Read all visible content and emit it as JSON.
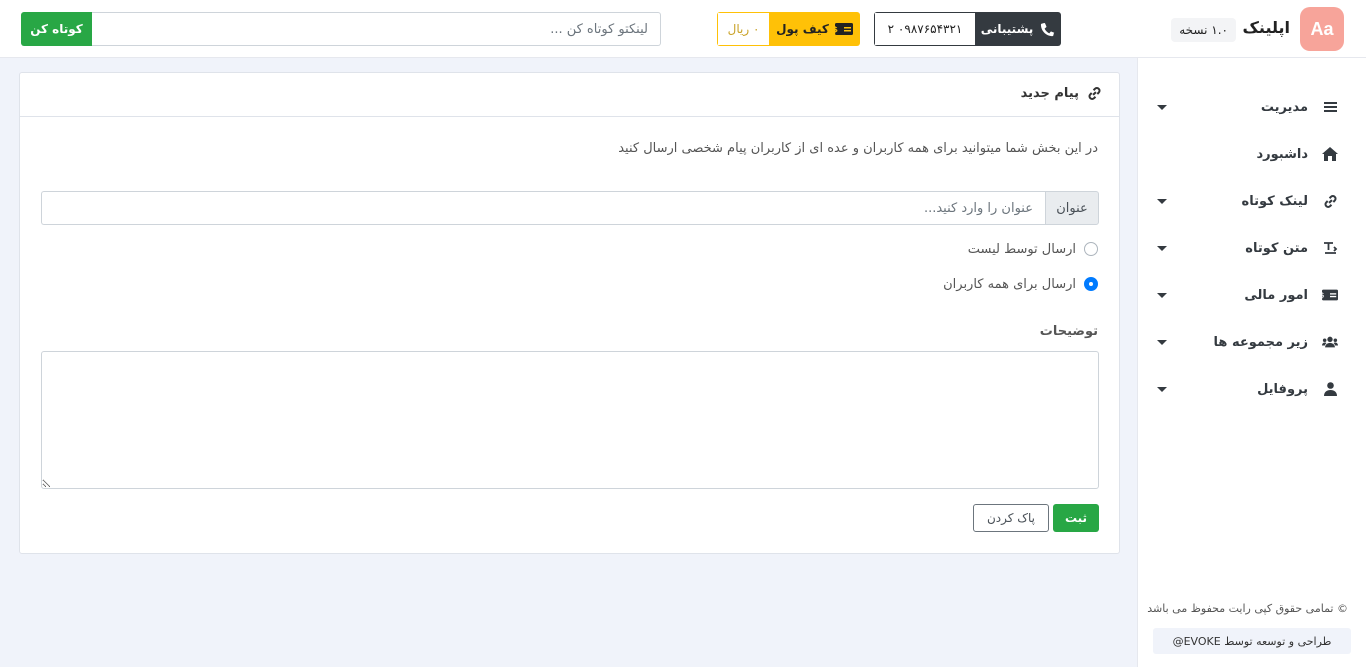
{
  "header": {
    "logo_text": "Aa",
    "app_name": "اپلینک",
    "version": "۱.۰ نسخه",
    "support_label": "پشتیبانی",
    "support_phone": "۰۹۸۷۶۵۴۳۲۱ ۲",
    "wallet_label": "کیف پول",
    "wallet_amount": "۰ ریال",
    "shorten_placeholder": "لینکتو کوتاه کن ...",
    "shorten_button": "کوتاه کن"
  },
  "sidebar": {
    "items": [
      {
        "label": "مدیریت",
        "icon": "bars-icon",
        "has_caret": true
      },
      {
        "label": "داشبورد",
        "icon": "home-icon",
        "has_caret": false
      },
      {
        "label": "لینک کوتاه",
        "icon": "link-icon",
        "has_caret": true
      },
      {
        "label": "متن کوتاه",
        "icon": "text-icon",
        "has_caret": true
      },
      {
        "label": "امور مالی",
        "icon": "money-icon",
        "has_caret": true
      },
      {
        "label": "زیر مجموعه ها",
        "icon": "users-icon",
        "has_caret": true
      },
      {
        "label": "پروفایل",
        "icon": "user-icon",
        "has_caret": true
      }
    ],
    "copyright": "© تمامی حقوق کپی رایت محفوظ می باشد",
    "credit": "طراحی و توسعه توسط EVOKE@"
  },
  "main": {
    "card_title": "پیام جدید",
    "intro": "در این بخش شما میتوانید برای همه کاربران و عده ای از کاربران پیام شخصی ارسال کنید",
    "title_label": "عنوان",
    "title_placeholder": "عنوان را وارد کنید...",
    "radio_list_label": "ارسال توسط لیست",
    "radio_all_label": "ارسال برای همه کاربران",
    "selected_radio": "all",
    "description_label": "توضیحات",
    "submit_button": "ثبت",
    "clear_button": "پاک کردن"
  },
  "colors": {
    "accent_green": "#28a745",
    "wallet_yellow": "#ffc107",
    "dark": "#343a40",
    "logo_bg": "#f7a49a",
    "radio_blue": "#007bff"
  }
}
